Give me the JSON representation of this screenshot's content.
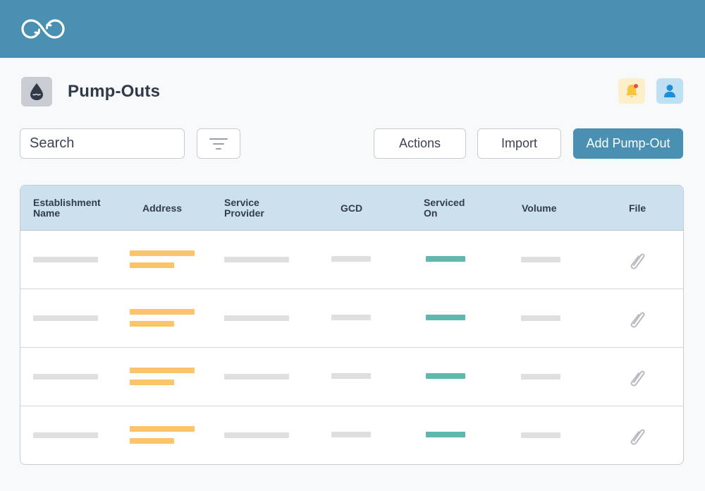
{
  "header": {
    "logo_icon": "infinity-sync-icon",
    "brand_color": "#4a90b3"
  },
  "page": {
    "title": "Pump-Outs",
    "icon": "water-drop-icon"
  },
  "top_actions": {
    "bell_icon": "bell-icon",
    "user_icon": "user-icon"
  },
  "toolbar": {
    "search_label": "Search",
    "filter_icon": "filter-icon",
    "actions_label": "Actions",
    "import_label": "Import",
    "add_label": "Add Pump-Out"
  },
  "table": {
    "columns": [
      {
        "line1": "Establishment",
        "line2": "Name"
      },
      {
        "line1": "Address",
        "line2": ""
      },
      {
        "line1": "Service",
        "line2": "Provider"
      },
      {
        "line1": "GCD",
        "line2": ""
      },
      {
        "line1": "Serviced",
        "line2": "On"
      },
      {
        "line1": "Volume",
        "line2": ""
      },
      {
        "line1": "File",
        "line2": ""
      }
    ],
    "row_count": 4,
    "file_icon": "paperclip-icon",
    "colors": {
      "placeholder": "#dedfe1",
      "address": "#fdc46b",
      "date": "#5fb7ad"
    }
  }
}
